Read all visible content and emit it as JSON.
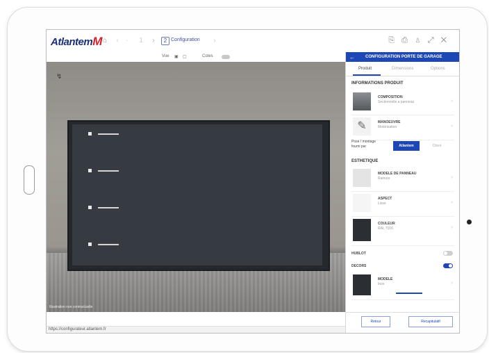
{
  "app": {
    "brand_main": "Atlantem",
    "brand_letter": "M",
    "breadcrumb_step": "2",
    "breadcrumb_label": "Configuration"
  },
  "subbar": {
    "item1": "Vue",
    "item2": "Cotes"
  },
  "panel": {
    "back_icon": "arrow-left",
    "title": "CONFIGURATION PORTE DE GARAGE",
    "tabs": [
      "Produit",
      "Dimensions",
      "Options"
    ],
    "product_info_title": "INFORMATIONS PRODUIT",
    "items": [
      {
        "name": "COMPOSITION",
        "sub": "Sectionnelle a panneau"
      },
      {
        "name": "MANOEUVRE",
        "sub": "Motorisation"
      }
    ],
    "assembly_label": "Pose / montage fourni par",
    "btn_primary": "Atlantem",
    "btn_secondary": "Client",
    "esthetic_title": "ESTHETIQUE",
    "esth_items": [
      {
        "name": "MODELE DE PANNEAU",
        "sub": "Rainure"
      },
      {
        "name": "ASPECT",
        "sub": "Lisse"
      },
      {
        "name": "COULEUR",
        "sub": "RAL 7016"
      }
    ],
    "toggle1": "HUBLOT",
    "toggle2": "DECORS",
    "decor_item": {
      "name": "MODELE",
      "sub": "Inox"
    },
    "footer_back": "Retour",
    "footer_next": "Recapitulatif"
  },
  "scene": {
    "bottom_text": "Illustration non contractuelle"
  },
  "status": {
    "url": "https://configurateur.atlantem.fr"
  },
  "colors": {
    "brand_blue": "#1c47b5",
    "brand_red": "#d8202a",
    "door": "#353b41"
  }
}
